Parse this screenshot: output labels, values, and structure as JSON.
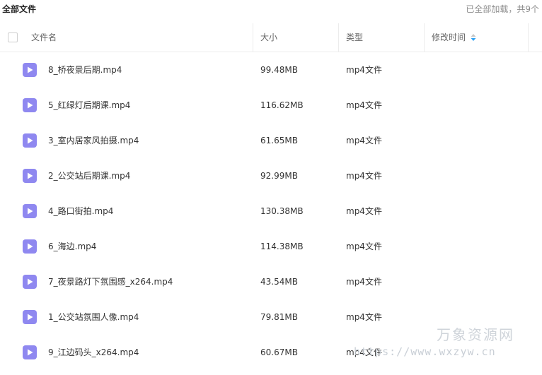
{
  "header_bar": {
    "title": "全部文件",
    "status": "已全部加载，共9个"
  },
  "columns": {
    "name": "文件名",
    "size": "大小",
    "type": "类型",
    "modified": "修改时间"
  },
  "files": [
    {
      "name": "8_桥夜景后期.mp4",
      "size": "99.48MB",
      "type": "mp4文件"
    },
    {
      "name": "5_红绿灯后期课.mp4",
      "size": "116.62MB",
      "type": "mp4文件"
    },
    {
      "name": "3_室内居家风拍摄.mp4",
      "size": "61.65MB",
      "type": "mp4文件"
    },
    {
      "name": "2_公交站后期课.mp4",
      "size": "92.99MB",
      "type": "mp4文件"
    },
    {
      "name": "4_路口街拍.mp4",
      "size": "130.38MB",
      "type": "mp4文件"
    },
    {
      "name": "6_海边.mp4",
      "size": "114.38MB",
      "type": "mp4文件"
    },
    {
      "name": "7_夜景路灯下氛围感_x264.mp4",
      "size": "43.54MB",
      "type": "mp4文件"
    },
    {
      "name": "1_公交站氛围人像.mp4",
      "size": "79.81MB",
      "type": "mp4文件"
    },
    {
      "name": "9_江边码头_x264.mp4",
      "size": "60.67MB",
      "type": "mp4文件"
    }
  ],
  "watermark": {
    "text": "万象资源网",
    "url": "https://www.wxzyw.cn"
  },
  "colors": {
    "video_icon": "#8f88f0",
    "sort_up": "#c8c8c8",
    "sort_down": "#2fa4f5"
  },
  "icons": {
    "file": "video-file-icon",
    "sort": "sort-icon",
    "select_all": "checkbox"
  }
}
